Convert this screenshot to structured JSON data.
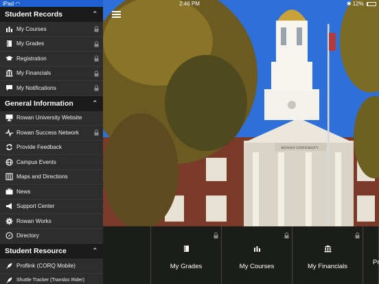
{
  "status_bar": {
    "device": "iPad",
    "time": "2:46 PM",
    "battery": "12%",
    "battery_level": 0.12
  },
  "sidebar": {
    "sections": [
      {
        "title": "Student Records",
        "items": [
          {
            "label": "My Courses",
            "icon": "bar-chart-icon",
            "locked": true
          },
          {
            "label": "My Grades",
            "icon": "book-icon",
            "locked": true
          },
          {
            "label": "Registration",
            "icon": "graduation-cap-icon",
            "locked": true
          },
          {
            "label": "My Financials",
            "icon": "bank-icon",
            "locked": true
          },
          {
            "label": "My Notifications",
            "icon": "chat-bubble-icon",
            "locked": true
          }
        ]
      },
      {
        "title": "General Information",
        "items": [
          {
            "label": "Rowan University Website",
            "icon": "monitor-icon",
            "locked": false
          },
          {
            "label": "Rowan Success Network",
            "icon": "pulse-icon",
            "locked": true
          },
          {
            "label": "Provide Feedback",
            "icon": "refresh-icon",
            "locked": false
          },
          {
            "label": "Campus Events",
            "icon": "globe-icon",
            "locked": false
          },
          {
            "label": "Maps and Directions",
            "icon": "map-icon",
            "locked": false
          },
          {
            "label": "News",
            "icon": "tv-icon",
            "locked": false
          },
          {
            "label": "Support Center",
            "icon": "megaphone-icon",
            "locked": false
          },
          {
            "label": "Rowan Works",
            "icon": "gear-icon",
            "locked": false
          },
          {
            "label": "Directory",
            "icon": "compass-icon",
            "locked": false
          }
        ]
      },
      {
        "title": "Student Resource",
        "items": [
          {
            "label": "Proflink (CORQ Mobile)",
            "icon": "rocket-icon",
            "locked": false
          },
          {
            "label": "Shuttle Tracker (Transloc Rider)",
            "icon": "rocket-icon",
            "locked": false
          }
        ]
      }
    ]
  },
  "tiles": [
    {
      "label": "My Grades",
      "icon": "book-icon",
      "locked": true
    },
    {
      "label": "My Courses",
      "icon": "bar-chart-icon",
      "locked": true
    },
    {
      "label": "My Financials",
      "icon": "bank-icon",
      "locked": true
    },
    {
      "label": "Pr",
      "icon": "none",
      "locked": false
    }
  ],
  "building_sign": "ROWAN UNIVERSITY"
}
